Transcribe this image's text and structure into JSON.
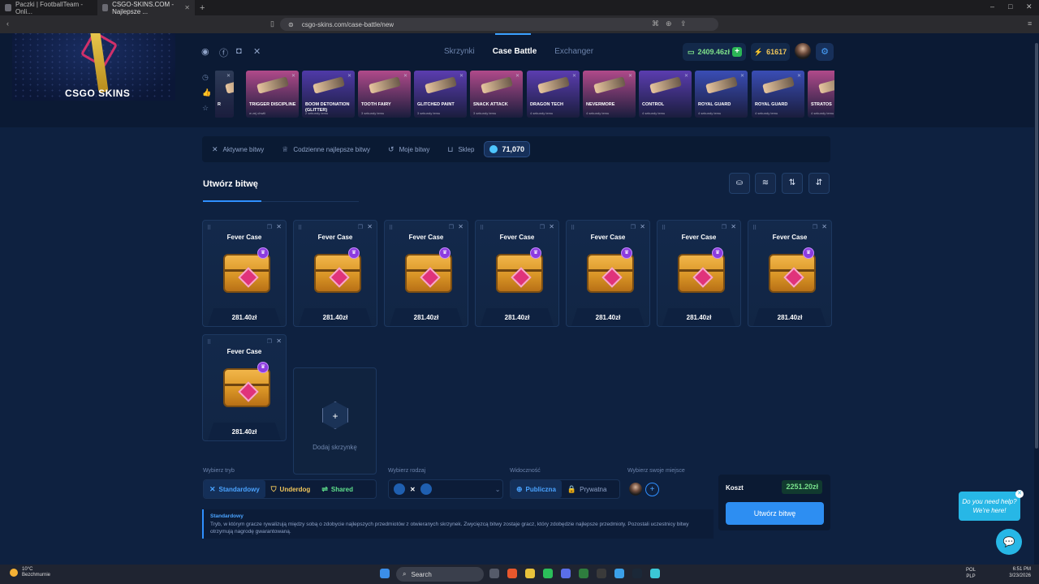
{
  "browser": {
    "tabs": [
      {
        "title": "Paczki | FootballTeam - Onli..."
      },
      {
        "title": "CSGO-SKINS.COM - Najlepsze ..."
      }
    ],
    "new_tab": "+",
    "url": "csgo-skins.com/case-battle/new",
    "window_controls": [
      "–",
      "□",
      "✕"
    ]
  },
  "header": {
    "logo_text": "CSGO SKINS",
    "social": [
      "discord-icon",
      "facebook-icon",
      "instagram-icon",
      "x-icon"
    ],
    "nav": [
      {
        "label": "Skrzynki",
        "active": false
      },
      {
        "label": "Case Battle",
        "active": true
      },
      {
        "label": "Exchanger",
        "active": false
      }
    ],
    "balance": "2409.46zł",
    "balance_add": "+",
    "coins": "61617",
    "settings_icon": "gear-icon"
  },
  "live_drops": [
    {
      "name": "R",
      "sub": "",
      "color": "#2d3b57"
    },
    {
      "name": "TRIGGER DISCIPLINE",
      "sub": "w zej chwili",
      "color": "#b04a8a"
    },
    {
      "name": "BOOM DETONATION (GLITTER)",
      "sub": "2 sekundy temu",
      "color": "#4f3aa8"
    },
    {
      "name": "TOOTH FAIRY",
      "sub": "3 sekundy temu",
      "color": "#b04a8a"
    },
    {
      "name": "GLITCHED PAINT",
      "sub": "3 sekundy temu",
      "color": "#5b3db0"
    },
    {
      "name": "SNACK ATTACK",
      "sub": "3 sekundy temu",
      "color": "#b04a8a"
    },
    {
      "name": "DRAGON TECH",
      "sub": "4 sekundy temu",
      "color": "#5b3db0"
    },
    {
      "name": "NEVERMORE",
      "sub": "4 sekundy temu",
      "color": "#b04a8a"
    },
    {
      "name": "CONTROL",
      "sub": "4 sekundy temu",
      "color": "#5b3db0"
    },
    {
      "name": "ROYAL GUARD",
      "sub": "4 sekundy temu",
      "color": "#3a4db5"
    },
    {
      "name": "ROYAL GUARD",
      "sub": "4 sekundy temu",
      "color": "#3a4db5"
    },
    {
      "name": "STRATOS",
      "sub": "4 sekundy temu",
      "color": "#b04a8a"
    }
  ],
  "subnav": {
    "items": [
      {
        "label": "Aktywne bitwy",
        "icon": "swords-icon"
      },
      {
        "label": "Codzienne najlepsze bitwy",
        "icon": "trophy-icon"
      },
      {
        "label": "Moje bitwy",
        "icon": "history-icon"
      },
      {
        "label": "Sklep",
        "icon": "basket-icon"
      }
    ],
    "gems": "71,070"
  },
  "page": {
    "title": "Utwórz bitwę",
    "tools": [
      "cases-icon",
      "layers-icon",
      "sort-asc-icon",
      "sort-desc-icon"
    ]
  },
  "cases": [
    {
      "name": "Fever Case",
      "price": "281.40zł"
    },
    {
      "name": "Fever Case",
      "price": "281.40zł"
    },
    {
      "name": "Fever Case",
      "price": "281.40zł"
    },
    {
      "name": "Fever Case",
      "price": "281.40zł"
    },
    {
      "name": "Fever Case",
      "price": "281.40zł"
    },
    {
      "name": "Fever Case",
      "price": "281.40zł"
    },
    {
      "name": "Fever Case",
      "price": "281.40zł"
    },
    {
      "name": "Fever Case",
      "price": "281.40zł"
    }
  ],
  "add_case": {
    "label": "Dodaj skrzynkę",
    "icon": "+"
  },
  "options": {
    "mode_label": "Wybierz tryb",
    "modes": [
      {
        "label": "Standardowy",
        "selected": true
      },
      {
        "label": "Underdog",
        "selected": false
      },
      {
        "label": "Shared",
        "selected": false
      }
    ],
    "type_label": "Wybierz rodzaj",
    "type_sep": "✕",
    "visibility_label": "Widoczność",
    "visibility": [
      {
        "label": "Publiczna",
        "selected": true
      },
      {
        "label": "Prywatna",
        "selected": false
      }
    ],
    "seat_label": "Wybierz swoje miejsce"
  },
  "description": {
    "title": "Standardowy",
    "text": "Tryb, w którym gracze rywalizują między sobą o zdobycie najlepszych przedmiotów z otwieranych skrzynek. Zwycięzcą bitwy zostaje gracz, który zdobędzie najlepsze przedmioty. Pozostali uczestnicy bitwy otrzymują nagrodę gwarantowaną."
  },
  "summary": {
    "cost_label": "Koszt",
    "cost_value": "2251.20zł",
    "create_label": "Utwórz bitwę"
  },
  "help": {
    "line1": "Do you need help?",
    "line2": "We're here!"
  },
  "taskbar": {
    "weather_temp": "10°C",
    "weather_desc": "Bezchmurnie",
    "search": "Search",
    "lang1": "POL",
    "lang2": "PLP",
    "time": "6:51 PM",
    "date": "3/23/2026"
  }
}
